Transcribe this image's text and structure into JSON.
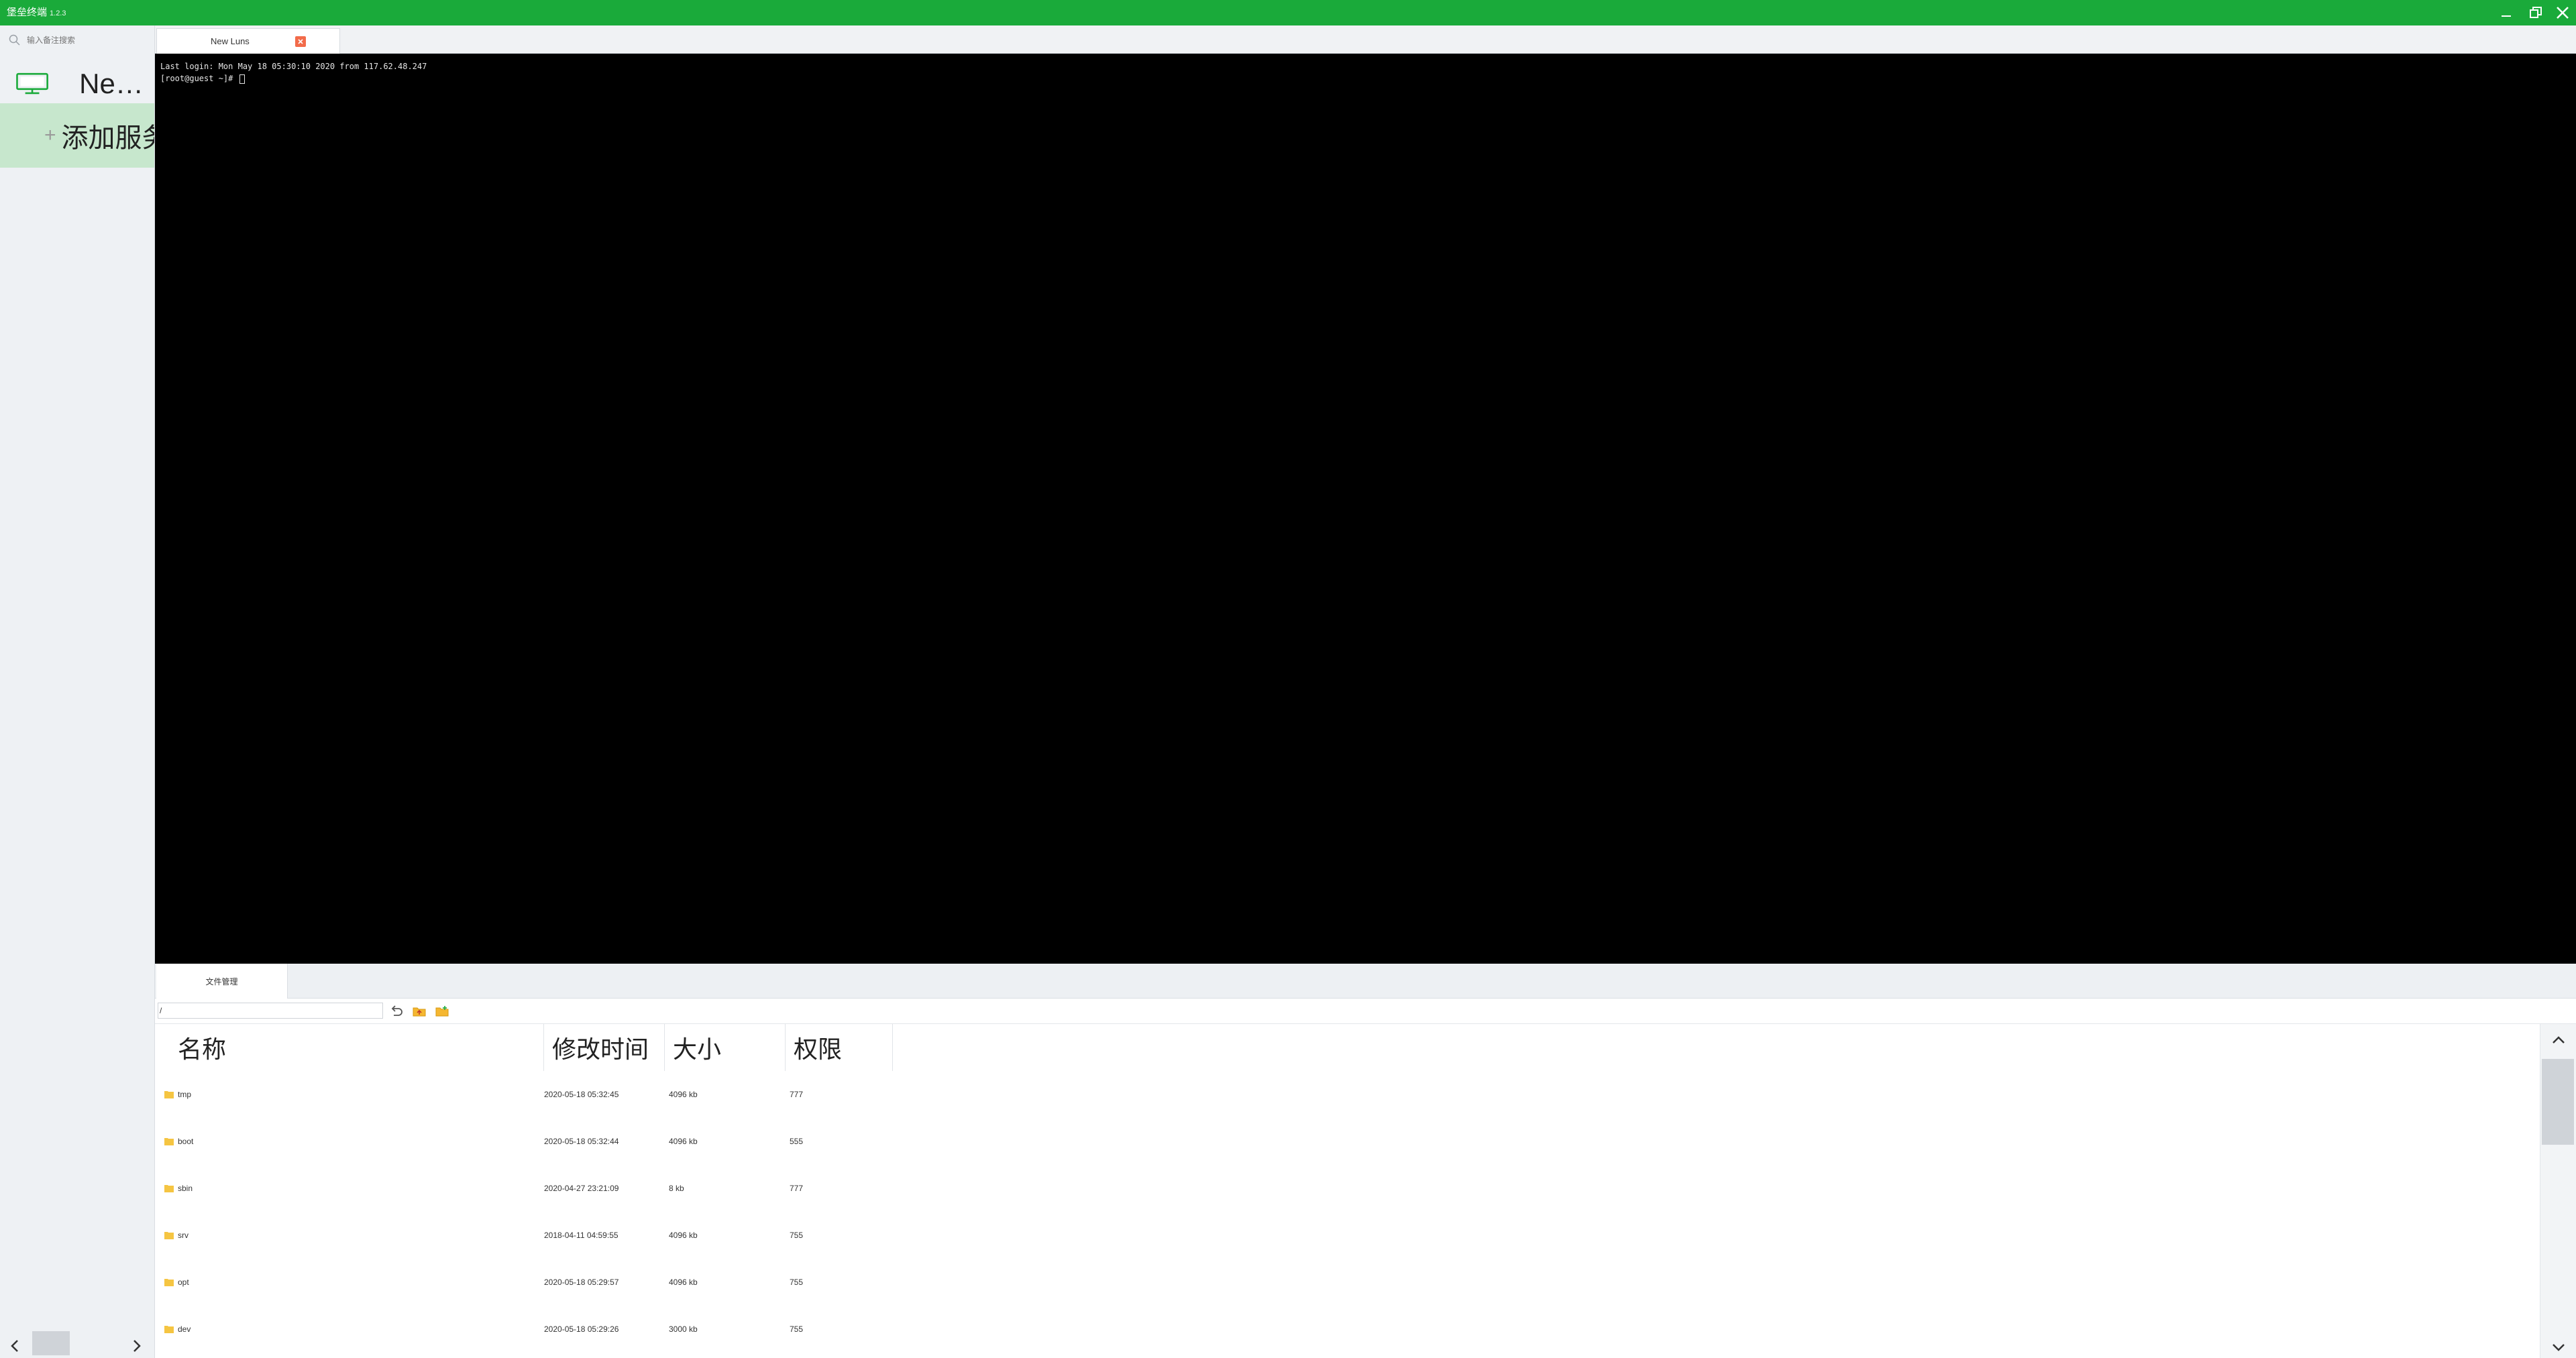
{
  "window": {
    "title": "堡垒终端",
    "version": "1.2.3",
    "colors": {
      "titlebar": "#1aaa3a",
      "selection": "#c7e7cd",
      "close_tab": "#f26b4a"
    }
  },
  "sidebar": {
    "search_placeholder": "输入备注搜索",
    "hosts": [
      {
        "name": "New Luns",
        "display": "New ..."
      }
    ],
    "add_server_label": "添加服务器",
    "add_server_visible": "添加服务"
  },
  "tabs": [
    {
      "label": "New Luns"
    }
  ],
  "terminal": {
    "lines": [
      "Last login: Mon May 18 05:30:10 2020 from 117.62.48.247",
      "[root@guest ~]# "
    ]
  },
  "file_manager": {
    "tab_label": "文件管理",
    "path": "/",
    "columns": [
      "名称",
      "修改时间",
      "大小",
      "权限"
    ],
    "rows": [
      {
        "name": "tmp",
        "modified": "2020-05-18 05:32:45",
        "size": "4096 kb",
        "perm": "777"
      },
      {
        "name": "boot",
        "modified": "2020-05-18 05:32:44",
        "size": "4096 kb",
        "perm": "555"
      },
      {
        "name": "sbin",
        "modified": "2020-04-27 23:21:09",
        "size": "8 kb",
        "perm": "777"
      },
      {
        "name": "srv",
        "modified": "2018-04-11 04:59:55",
        "size": "4096 kb",
        "perm": "755"
      },
      {
        "name": "opt",
        "modified": "2020-05-18 05:29:57",
        "size": "4096 kb",
        "perm": "755"
      },
      {
        "name": "dev",
        "modified": "2020-05-18 05:29:26",
        "size": "3000 kb",
        "perm": "755"
      }
    ]
  }
}
